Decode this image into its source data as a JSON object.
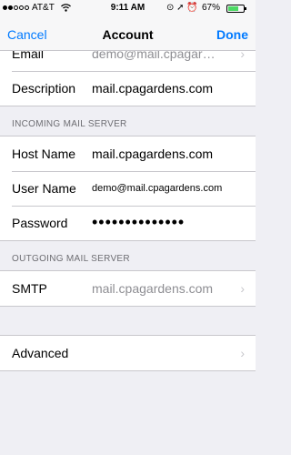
{
  "status_bar": {
    "carrier": "AT&T",
    "time": "9:11 AM",
    "battery": "67%",
    "battery_level": 0.67
  },
  "nav": {
    "cancel_label": "Cancel",
    "title": "Account",
    "done_label": "Done"
  },
  "account": {
    "email_label": "Email",
    "email_value": "demo@mail.cpagar…",
    "description_label": "Description",
    "description_value": "mail.cpagardens.com"
  },
  "incoming": {
    "header": "INCOMING MAIL SERVER",
    "host_label": "Host Name",
    "host_value": "mail.cpagardens.com",
    "user_label": "User Name",
    "user_value": "demo@mail.cpagardens.com",
    "password_label": "Password",
    "password_value": "••••••••••••••"
  },
  "outgoing": {
    "header": "OUTGOING MAIL SERVER",
    "smtp_label": "SMTP",
    "smtp_value": "mail.cpagardens.com"
  },
  "advanced": {
    "label": "Advanced"
  }
}
